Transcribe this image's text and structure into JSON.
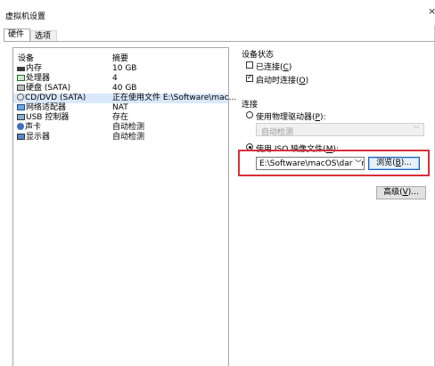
{
  "window": {
    "title": "虚拟机设置",
    "close_glyph": "×"
  },
  "tabs": [
    {
      "label": "硬件"
    },
    {
      "label": "选项"
    }
  ],
  "device_list": {
    "col_device": "设备",
    "col_summary": "摘要",
    "rows": [
      {
        "icon": "memory-icon",
        "name": "内存",
        "summary": "10 GB"
      },
      {
        "icon": "processor-icon",
        "name": "处理器",
        "summary": "4"
      },
      {
        "icon": "hard-disk-icon",
        "name": "硬盘 (SATA)",
        "summary": "40 GB"
      },
      {
        "icon": "cd-dvd-icon",
        "name": "CD/DVD (SATA)",
        "summary": "正在使用文件 E:\\Software\\mac..."
      },
      {
        "icon": "network-adapter-icon",
        "name": "网络适配器",
        "summary": "NAT"
      },
      {
        "icon": "usb-controller-icon",
        "name": "USB 控制器",
        "summary": "存在"
      },
      {
        "icon": "sound-card-icon",
        "name": "声卡",
        "summary": "自动检测"
      },
      {
        "icon": "display-icon",
        "name": "显示器",
        "summary": "自动检测"
      }
    ],
    "selected_index": 3
  },
  "device_status": {
    "title": "设备状态",
    "connected": {
      "label_pre": "已连接(",
      "key": "C",
      "label_post": ")",
      "checked": false
    },
    "connect_on_power": {
      "label_pre": "启动时连接(",
      "key": "O",
      "label_post": ")",
      "checked": true
    }
  },
  "connection": {
    "title": "连接",
    "physical_drive": {
      "label_pre": "使用物理驱动器(",
      "key": "P",
      "label_post": "):",
      "selected": false
    },
    "physical_drive_value": "自动检测",
    "iso_image": {
      "label_pre": "使用 ISO 映像文件(",
      "key": "M",
      "label_post": "):",
      "selected": true
    },
    "iso_path": "E:\\Software\\macOS\\darwin.",
    "browse_button": {
      "label_pre": "浏览(",
      "key": "B",
      "label_post": ")..."
    }
  },
  "advanced_button": {
    "label_pre": "高级(",
    "key": "V",
    "label_post": ")..."
  },
  "colors": {
    "highlight_border": "#d8303a",
    "selected_row": "#d9e8fb"
  }
}
